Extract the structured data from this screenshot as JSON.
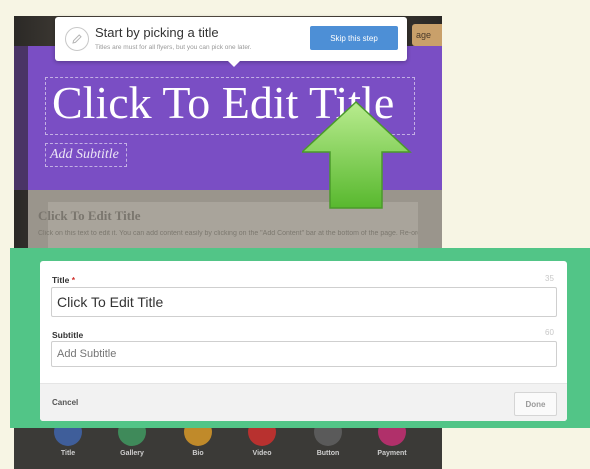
{
  "tooltip": {
    "title": "Start by picking a title",
    "subtitle": "Titles are must for all flyers, but you can pick one later.",
    "skip_label": "Skip this step"
  },
  "editor": {
    "partial_button_label": "age",
    "title": "Click To Edit Title",
    "subtitle": "Add Subtitle",
    "card_title": "Click To Edit Title",
    "card_text": "Click on this text to edit it. You can add content easily by clicking on the \"Add Content\" bar at the bottom of the page. Re-order and remove items by clicking on them.",
    "hero_color": "#7a4ec4"
  },
  "modal": {
    "title_label": "Title",
    "required_mark": "*",
    "title_counter": "35",
    "title_value": "Click To Edit Title",
    "subtitle_label": "Subtitle",
    "subtitle_counter": "60",
    "subtitle_placeholder": "Add Subtitle",
    "cancel_label": "Cancel",
    "done_label": "Done",
    "frame_color": "#52c587"
  },
  "toolbar": {
    "items": [
      {
        "label": "Title",
        "icon": "title-icon",
        "color": "#3f5e9a"
      },
      {
        "label": "Gallery",
        "icon": "gallery-icon",
        "color": "#3f8a5a"
      },
      {
        "label": "Bio",
        "icon": "bio-icon",
        "color": "#c08a2a"
      },
      {
        "label": "Video",
        "icon": "video-icon",
        "color": "#b8312f"
      },
      {
        "label": "Button",
        "icon": "button-icon",
        "color": "#5a5a5a"
      },
      {
        "label": "Payment",
        "icon": "payment-icon",
        "color": "#b0306a"
      }
    ]
  }
}
